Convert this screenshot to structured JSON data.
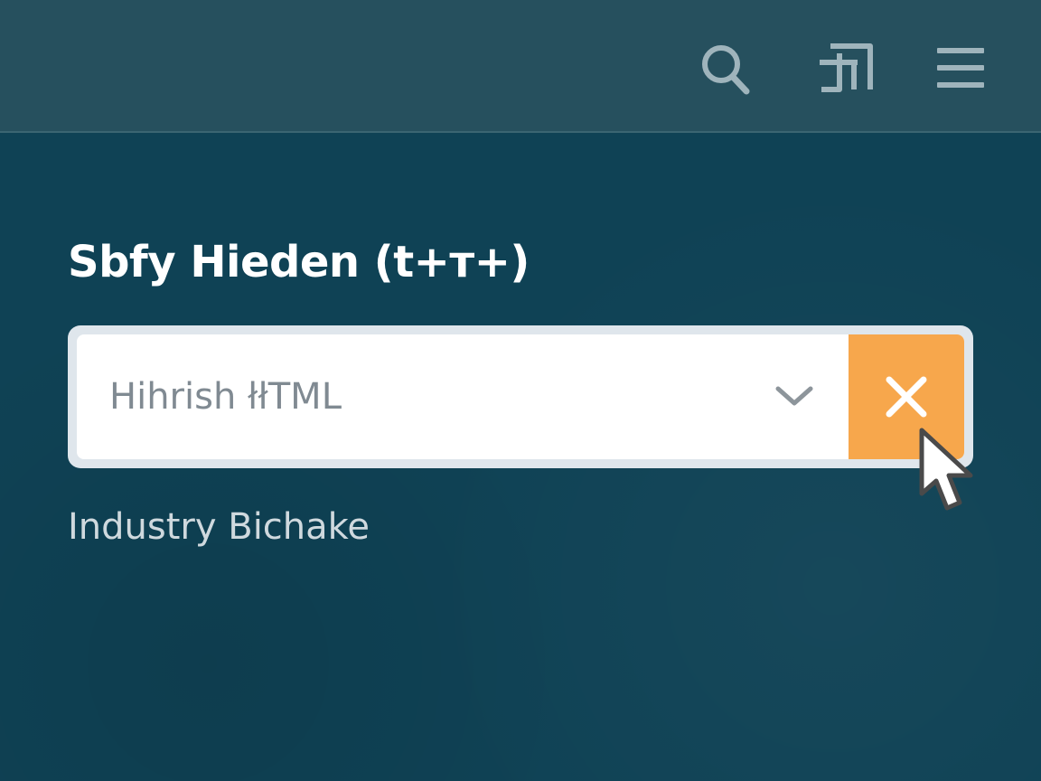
{
  "header": {
    "icons": [
      "search-icon",
      "pin-grid-icon",
      "hamburger-menu-icon"
    ]
  },
  "main": {
    "title": "Sbfy Hieden (t+т+)",
    "combobox": {
      "value": "Hihrish łłTML",
      "dropdown_icon": "chevron-down-icon",
      "clear_icon": "close-icon"
    },
    "subtitle": "Industry Bichake"
  },
  "colors": {
    "background": "#0f4255",
    "topbar": "#26505e",
    "accent": "#f7a74c",
    "input_bg": "#ffffff",
    "input_border": "#dfe6ec"
  }
}
